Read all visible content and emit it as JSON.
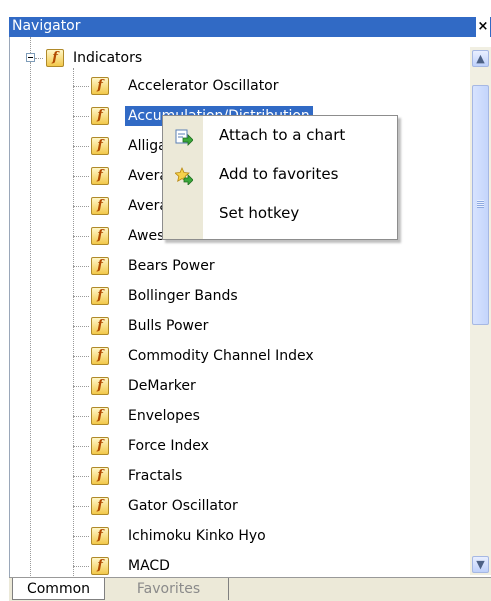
{
  "window": {
    "title": "Navigator",
    "close_glyph": "×"
  },
  "tree": {
    "root": {
      "label": "Indicators",
      "icon": "function-icon"
    },
    "items": [
      {
        "label": "Accelerator Oscillator"
      },
      {
        "label": "Accumulation/Distribution",
        "selected": true
      },
      {
        "label": "Alligator"
      },
      {
        "label": "Average Directional Movement Index"
      },
      {
        "label": "Average True Range"
      },
      {
        "label": "Awesome Oscillator"
      },
      {
        "label": "Bears Power"
      },
      {
        "label": "Bollinger Bands"
      },
      {
        "label": "Bulls Power"
      },
      {
        "label": "Commodity Channel Index"
      },
      {
        "label": "DeMarker"
      },
      {
        "label": "Envelopes"
      },
      {
        "label": "Force Index"
      },
      {
        "label": "Fractals"
      },
      {
        "label": "Gator Oscillator"
      },
      {
        "label": "Ichimoku Kinko Hyo"
      },
      {
        "label": "MACD"
      }
    ],
    "icon_glyph": "f"
  },
  "context_menu": {
    "items": [
      {
        "label": "Attach to a chart",
        "icon": "attach-chart-icon"
      },
      {
        "label": "Add to favorites",
        "icon": "favorites-star-icon"
      },
      {
        "label": "Set hotkey",
        "icon": ""
      }
    ]
  },
  "scrollbar": {
    "up_glyph": "▲",
    "down_glyph": "▼"
  },
  "tabs": [
    {
      "label": "Common",
      "active": true
    },
    {
      "label": "Favorites",
      "active": false
    }
  ]
}
